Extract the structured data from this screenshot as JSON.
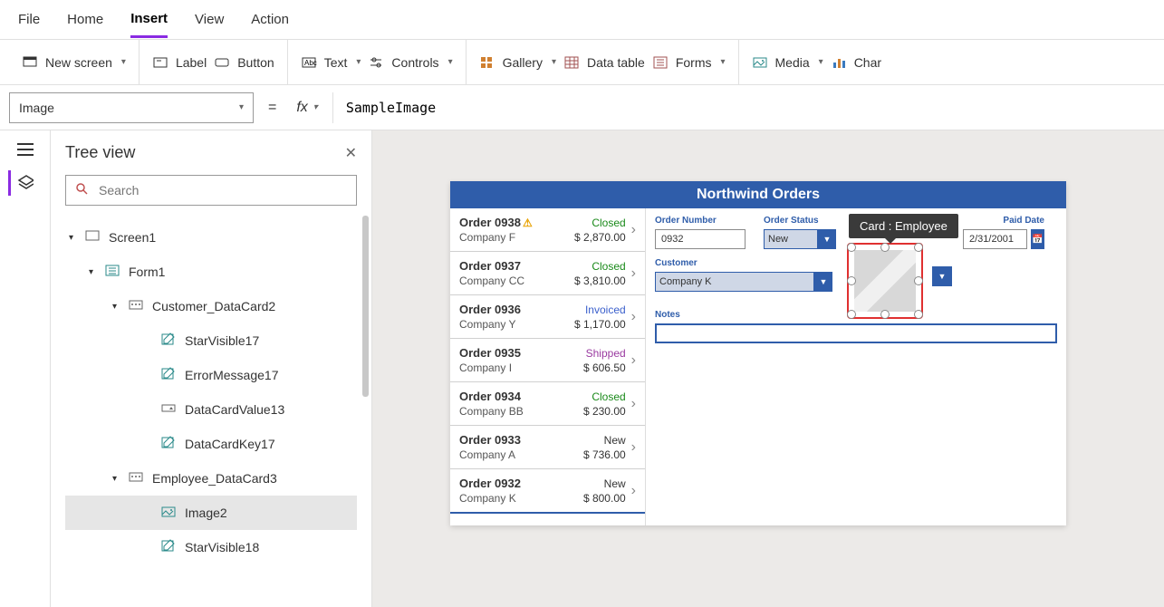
{
  "menubar": {
    "items": [
      "File",
      "Home",
      "Insert",
      "View",
      "Action"
    ],
    "active": "Insert"
  },
  "ribbon": {
    "newscreen": "New screen",
    "label": "Label",
    "button": "Button",
    "text": "Text",
    "controls": "Controls",
    "gallery": "Gallery",
    "datatable": "Data table",
    "forms": "Forms",
    "media": "Media",
    "charts": "Char"
  },
  "formula": {
    "property": "Image",
    "value": "SampleImage"
  },
  "tree": {
    "title": "Tree view",
    "search_placeholder": "Search",
    "items": [
      {
        "level": 0,
        "label": "Screen1",
        "caret": true,
        "icon": "screen"
      },
      {
        "level": 1,
        "label": "Form1",
        "caret": true,
        "icon": "form"
      },
      {
        "level": 2,
        "label": "Customer_DataCard2",
        "caret": true,
        "icon": "card"
      },
      {
        "level": 3,
        "label": "StarVisible17",
        "icon": "edit"
      },
      {
        "level": 3,
        "label": "ErrorMessage17",
        "icon": "edit"
      },
      {
        "level": 3,
        "label": "DataCardValue13",
        "icon": "dropdown"
      },
      {
        "level": 3,
        "label": "DataCardKey17",
        "icon": "edit"
      },
      {
        "level": 2,
        "label": "Employee_DataCard3",
        "caret": true,
        "icon": "card"
      },
      {
        "level": 3,
        "label": "Image2",
        "icon": "image",
        "selected": true
      },
      {
        "level": 3,
        "label": "StarVisible18",
        "icon": "edit"
      }
    ]
  },
  "app": {
    "title": "Northwind Orders",
    "orders": [
      {
        "num": "Order 0938",
        "warn": true,
        "company": "Company F",
        "status": "Closed",
        "status_class": "closed",
        "amount": "$ 2,870.00"
      },
      {
        "num": "Order 0937",
        "company": "Company CC",
        "status": "Closed",
        "status_class": "closed",
        "amount": "$ 3,810.00"
      },
      {
        "num": "Order 0936",
        "company": "Company Y",
        "status": "Invoiced",
        "status_class": "invoiced",
        "amount": "$ 1,170.00"
      },
      {
        "num": "Order 0935",
        "company": "Company I",
        "status": "Shipped",
        "status_class": "shipped",
        "amount": "$ 606.50"
      },
      {
        "num": "Order 0934",
        "company": "Company BB",
        "status": "Closed",
        "status_class": "closed",
        "amount": "$ 230.00"
      },
      {
        "num": "Order 0933",
        "company": "Company A",
        "status": "New",
        "status_class": "new",
        "amount": "$ 736.00"
      },
      {
        "num": "Order 0932",
        "company": "Company K",
        "status": "New",
        "status_class": "new",
        "amount": "$ 800.00",
        "selected": true
      }
    ],
    "detail": {
      "order_number_label": "Order Number",
      "order_number": "0932",
      "order_status_label": "Order Status",
      "order_status": "New",
      "paid_date_label": "Paid Date",
      "paid_date": "2/31/2001",
      "customer_label": "Customer",
      "customer": "Company K",
      "notes_label": "Notes",
      "tooltip": "Card : Employee"
    }
  }
}
